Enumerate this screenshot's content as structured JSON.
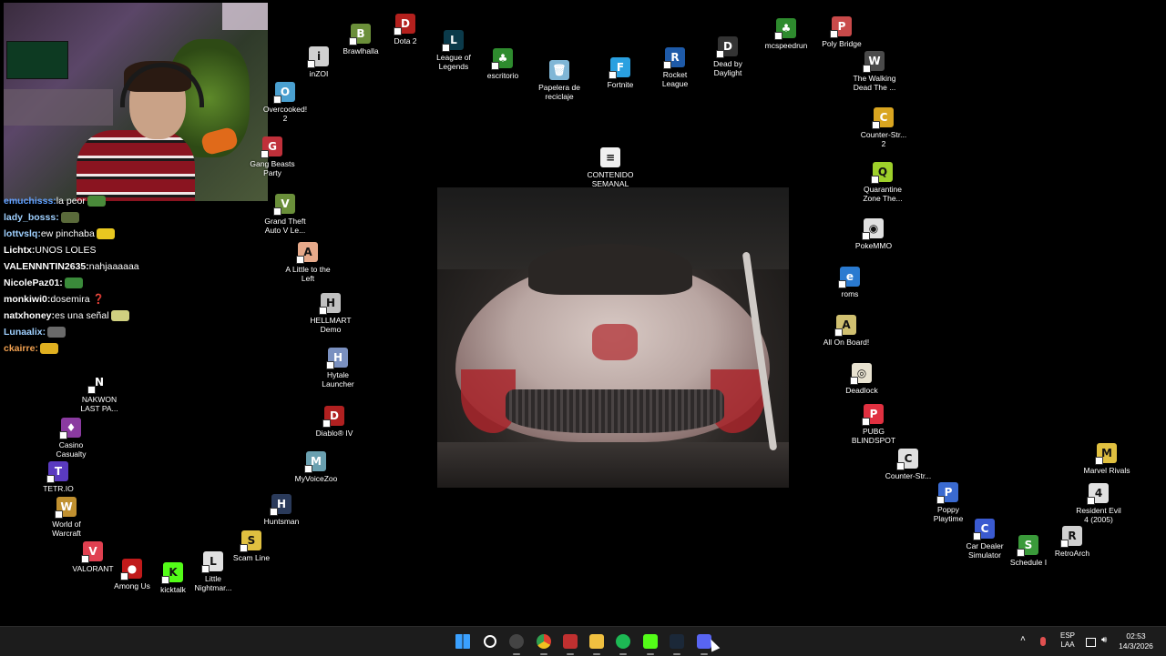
{
  "desktop_icons": [
    {
      "label": "Brawlhalla",
      "icon": "brawlhalla-icon",
      "color": "#6b8f3a",
      "glyph": "B"
    },
    {
      "label": "Dota 2",
      "icon": "dota2-icon",
      "color": "#b3201d",
      "glyph": "D"
    },
    {
      "label": "League of\nLegends",
      "icon": "league-icon",
      "color": "#0b3a4a",
      "glyph": "L"
    },
    {
      "label": "escritorio",
      "icon": "tree-icon",
      "color": "#2e8b2e",
      "glyph": "♣"
    },
    {
      "label": "Papelera de\nreciclaje",
      "icon": "recycle-bin-icon",
      "color": "#7fb6d6",
      "glyph": "🗑"
    },
    {
      "label": "Fortnite",
      "icon": "fortnite-icon",
      "color": "#2aa0e0",
      "glyph": "F"
    },
    {
      "label": "Rocket\nLeague",
      "icon": "rocket-league-icon",
      "color": "#1e5aa8",
      "glyph": "R"
    },
    {
      "label": "Dead by\nDaylight",
      "icon": "dbd-icon",
      "color": "#333333",
      "glyph": "D"
    },
    {
      "label": "mcspeedrun",
      "icon": "tree-icon",
      "color": "#2e8b2e",
      "glyph": "♣"
    },
    {
      "label": "Poly Bridge",
      "icon": "poly-bridge-icon",
      "color": "#c94a4a",
      "glyph": "P"
    },
    {
      "label": "inZOI",
      "icon": "inzoi-icon",
      "color": "#d0d0d0",
      "glyph": "i"
    },
    {
      "label": "Overcooked!\n2",
      "icon": "overcooked-icon",
      "color": "#4aa0d0",
      "glyph": "O"
    },
    {
      "label": "Gang Beasts\nParty",
      "icon": "party-icon",
      "color": "#c0303a",
      "glyph": "G"
    },
    {
      "label": "The Walking\nDead The ...",
      "icon": "walking-dead-icon",
      "color": "#4a4a4a",
      "glyph": "W"
    },
    {
      "label": "Counter-Str...\n2",
      "icon": "cs2-icon",
      "color": "#d9a520",
      "glyph": "C"
    },
    {
      "label": "CONTENIDO\nSEMANAL",
      "icon": "document-icon",
      "color": "#f0f0f0",
      "glyph": "≡"
    },
    {
      "label": "Grand Theft\nAuto V Le...",
      "icon": "gta-icon",
      "color": "#6a8f3a",
      "glyph": "V"
    },
    {
      "label": "Quarantine\nZone The...",
      "icon": "quarantine-icon",
      "color": "#9ed02a",
      "glyph": "Q"
    },
    {
      "label": "PokeMMO",
      "icon": "pokemmo-icon",
      "color": "#e0e0e0",
      "glyph": "◉"
    },
    {
      "label": "A Little to the\nLeft",
      "icon": "little-left-icon",
      "color": "#e6a98a",
      "glyph": "A"
    },
    {
      "label": "roms",
      "icon": "internet-explorer-icon",
      "color": "#2a7ad0",
      "glyph": "e"
    },
    {
      "label": "HELLMART\nDemo",
      "icon": "hellmart-icon",
      "color": "#c0c0c0",
      "glyph": "H"
    },
    {
      "label": "All On Board!",
      "icon": "all-on-board-icon",
      "color": "#d0c070",
      "glyph": "A"
    },
    {
      "label": "Hytale\nLauncher",
      "icon": "hytale-icon",
      "color": "#7a90c0",
      "glyph": "H"
    },
    {
      "label": "Deadlock",
      "icon": "deadlock-icon",
      "color": "#e8e2d0",
      "glyph": "◎"
    },
    {
      "label": "Diablo® IV",
      "icon": "diablo-icon",
      "color": "#b02020",
      "glyph": "D"
    },
    {
      "label": "PUBG\nBLINDSPOT",
      "icon": "pubg-icon",
      "color": "#e03040",
      "glyph": "P"
    },
    {
      "label": "NAKWON\nLAST PA...",
      "icon": "nakwon-icon",
      "color": "#000000",
      "glyph": "N"
    },
    {
      "label": "MyVoiceZoo",
      "icon": "myvoicezoo-icon",
      "color": "#6aa0b0",
      "glyph": "M"
    },
    {
      "label": "Counter-Str...",
      "icon": "cs-icon",
      "color": "#e0e0e0",
      "glyph": "C"
    },
    {
      "label": "Marvel Rivals",
      "icon": "marvel-rivals-icon",
      "color": "#e0c040",
      "glyph": "M"
    },
    {
      "label": "Casino\nCasualty",
      "icon": "casino-icon",
      "color": "#8a3aa0",
      "glyph": "♦"
    },
    {
      "label": "Poppy\nPlaytime",
      "icon": "poppy-icon",
      "color": "#3a6ad0",
      "glyph": "P"
    },
    {
      "label": "Resident Evil\n4 (2005)",
      "icon": "re4-icon",
      "color": "#e0e0e0",
      "glyph": "4"
    },
    {
      "label": "TETR.IO",
      "icon": "tetrio-icon",
      "color": "#5a3ac0",
      "glyph": "T"
    },
    {
      "label": "Huntsman",
      "icon": "huntsman-icon",
      "color": "#2a3a5a",
      "glyph": "H"
    },
    {
      "label": "World of\nWarcraft",
      "icon": "wow-icon",
      "color": "#c09030",
      "glyph": "W"
    },
    {
      "label": "Car Dealer\nSimulator",
      "icon": "car-dealer-icon",
      "color": "#3a5ad0",
      "glyph": "C"
    },
    {
      "label": "RetroArch",
      "icon": "retroarch-icon",
      "color": "#d0d0d0",
      "glyph": "R"
    },
    {
      "label": "Scam Line",
      "icon": "scam-line-icon",
      "color": "#e0c040",
      "glyph": "S"
    },
    {
      "label": "Schedule I",
      "icon": "schedule-icon",
      "color": "#3a9a3a",
      "glyph": "S"
    },
    {
      "label": "VALORANT",
      "icon": "valorant-icon",
      "color": "#e04050",
      "glyph": "V"
    },
    {
      "label": "Among Us",
      "icon": "among-us-icon",
      "color": "#c01a1a",
      "glyph": "●"
    },
    {
      "label": "kicktalk",
      "icon": "kicktalk-icon",
      "color": "#53fc18",
      "glyph": "K"
    },
    {
      "label": "Little\nNightmar...",
      "icon": "little-nightmares-icon",
      "color": "#e0e0e0",
      "glyph": "L"
    }
  ],
  "chat": [
    {
      "user": "emuchisss:",
      "msg": "la peor",
      "user_color": "#5fa0ff",
      "emote": "#4a8a3a"
    },
    {
      "user": "lady_bosss:",
      "msg": "",
      "user_color": "#9fd0ff",
      "emote": "#5a6a3a"
    },
    {
      "user": "lottvslq:",
      "msg": "ew pinchaba",
      "user_color": "#9fd0ff",
      "emote": "#e8c820"
    },
    {
      "user": "Lichtx:",
      "msg": "UNOS LOLES",
      "user_color": "#ffffff",
      "emote": ""
    },
    {
      "user": "VALENNNTIN2635:",
      "msg": "nahjaaaaaa",
      "user_color": "#ffffff",
      "emote": ""
    },
    {
      "user": "NicolePaz01:",
      "msg": "",
      "user_color": "#ffffff",
      "emote": "#3a8a3a"
    },
    {
      "user": "monkiwi0:",
      "msg": "dosemira ❓",
      "user_color": "#ffffff",
      "emote": ""
    },
    {
      "user": "natxhoney:",
      "msg": "es una señal",
      "user_color": "#ffffff",
      "emote": "#d0d080"
    },
    {
      "user": "Lunaalix:",
      "msg": "",
      "user_color": "#9fd0ff",
      "emote": "#6a6a6a"
    },
    {
      "user": "ckairre:",
      "msg": "",
      "user_color": "#f0a050",
      "emote": "#e0b020"
    }
  ],
  "taskbar": {
    "apps": [
      {
        "name": "start-button",
        "icon": "windows-icon",
        "color": "#3aa0ff"
      },
      {
        "name": "search-button",
        "icon": "search-icon",
        "color": "#ffffff"
      },
      {
        "name": "obs-app",
        "icon": "obs-icon",
        "color": "#444444"
      },
      {
        "name": "chrome-app",
        "icon": "chrome-icon",
        "color": "#e04030"
      },
      {
        "name": "streamer-app",
        "icon": "stream-app-icon",
        "color": "#c03030"
      },
      {
        "name": "explorer-app",
        "icon": "folder-icon",
        "color": "#f0c040"
      },
      {
        "name": "spotify-app",
        "icon": "spotify-icon",
        "color": "#1db954"
      },
      {
        "name": "kick-app",
        "icon": "kick-icon",
        "color": "#53fc18"
      },
      {
        "name": "steam-app",
        "icon": "steam-icon",
        "color": "#1b2838"
      },
      {
        "name": "discord-app",
        "icon": "discord-icon",
        "color": "#5865f2"
      }
    ],
    "lang_line1": "ESP",
    "lang_line2": "LAA",
    "time": "02:53",
    "date": "14/3/2026"
  }
}
